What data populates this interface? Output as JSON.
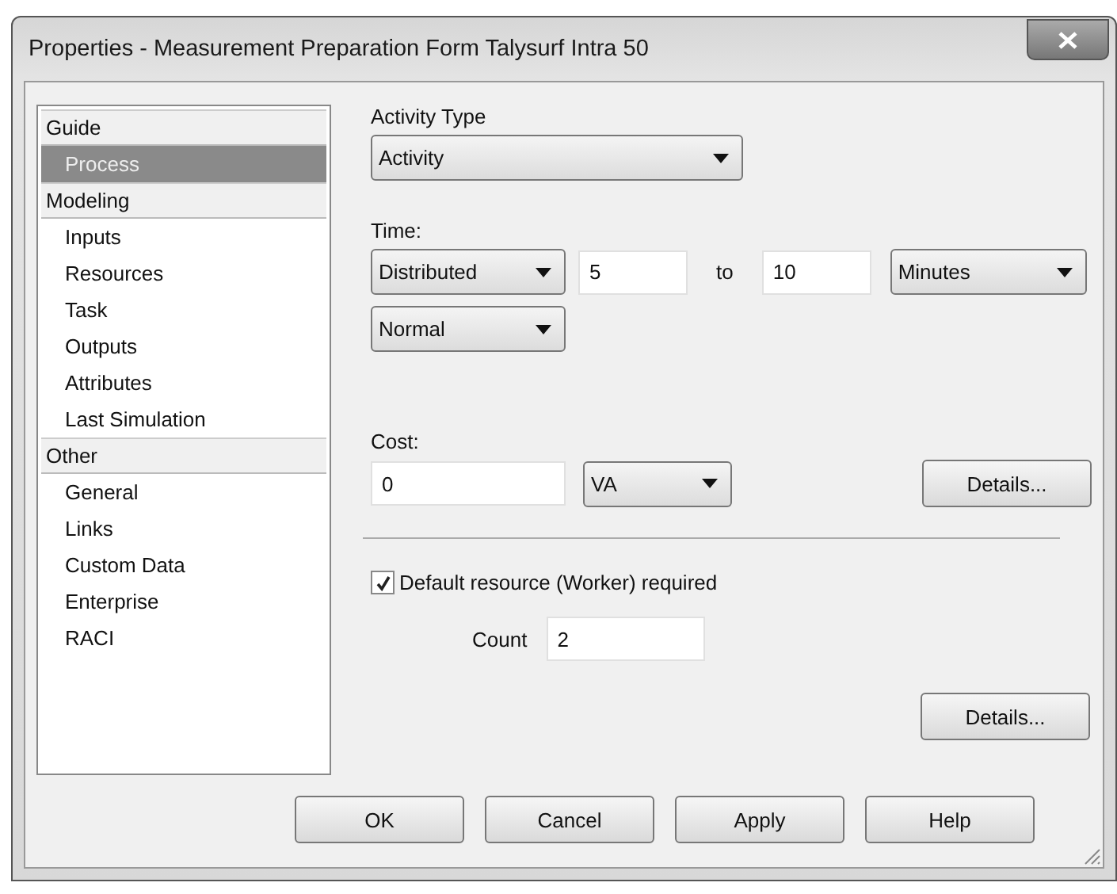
{
  "window": {
    "title": "Properties - Measurement  Preparation  Form Talysurf Intra 50"
  },
  "sidebar": {
    "items": [
      {
        "kind": "header",
        "label": "Guide",
        "selected": false
      },
      {
        "kind": "item",
        "label": "Process",
        "selected": true
      },
      {
        "kind": "header",
        "label": "Modeling",
        "selected": false
      },
      {
        "kind": "item",
        "label": "Inputs",
        "selected": false
      },
      {
        "kind": "item",
        "label": "Resources",
        "selected": false
      },
      {
        "kind": "item",
        "label": "Task",
        "selected": false
      },
      {
        "kind": "item",
        "label": "Outputs",
        "selected": false
      },
      {
        "kind": "item",
        "label": "Attributes",
        "selected": false
      },
      {
        "kind": "item",
        "label": "Last Simulation",
        "selected": false
      },
      {
        "kind": "header",
        "label": "Other",
        "selected": false
      },
      {
        "kind": "item",
        "label": "General",
        "selected": false
      },
      {
        "kind": "item",
        "label": "Links",
        "selected": false
      },
      {
        "kind": "item",
        "label": "Custom Data",
        "selected": false
      },
      {
        "kind": "item",
        "label": "Enterprise",
        "selected": false
      },
      {
        "kind": "item",
        "label": "RACI",
        "selected": false
      }
    ]
  },
  "activity_type": {
    "label": "Activity Type",
    "value": "Activity"
  },
  "time": {
    "label": "Time:",
    "mode": "Distributed",
    "from": "5",
    "to_label": "to",
    "to": "10",
    "unit": "Minutes",
    "distribution": "Normal"
  },
  "cost": {
    "label": "Cost:",
    "value": "0",
    "category": "VA",
    "details_button": "Details..."
  },
  "resource": {
    "checked": true,
    "label": "Default resource (Worker) required",
    "count_label": "Count",
    "count": "2",
    "details_button": "Details..."
  },
  "buttons": [
    "OK",
    "Cancel",
    "Apply",
    "Help"
  ]
}
